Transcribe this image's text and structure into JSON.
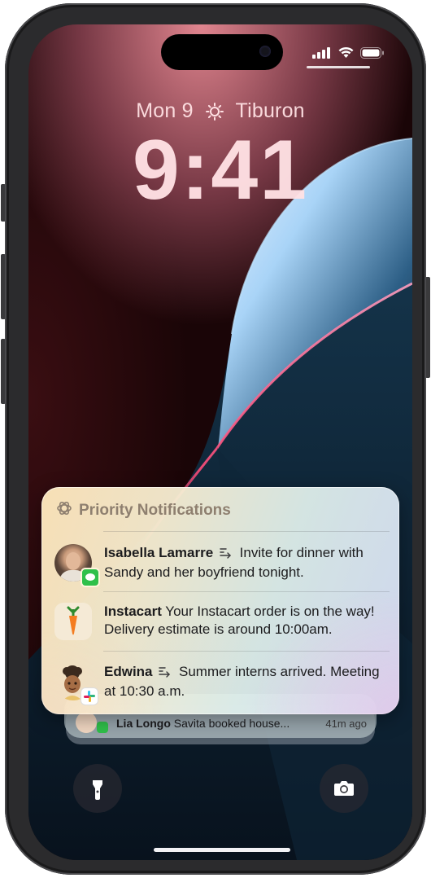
{
  "status_bar": {
    "signal_icon": "cellular-signal-icon",
    "wifi_icon": "wifi-icon",
    "battery_icon": "battery-icon"
  },
  "lock_screen": {
    "date": "Mon 9",
    "weather_icon": "sun-icon",
    "location": "Tiburon",
    "time": "9:41"
  },
  "priority_notifications": {
    "header_icon": "apple-intelligence-icon",
    "title": "Priority Notifications",
    "items": [
      {
        "sender": "Isabella Lamarre",
        "summary_icon": "summary-icon",
        "message": "Invite for dinner with Sandy and her boyfriend tonight.",
        "app_badge": "messages-icon"
      },
      {
        "sender": "Instacart",
        "message": "Your Instacart order is on the way! Delivery estimate is around 10:00am.",
        "app_icon": "carrot-icon"
      },
      {
        "sender": "Edwina",
        "summary_icon": "summary-icon",
        "message": "Summer interns arrived. Meeting at 10:30 a.m.",
        "app_badge": "slack-icon"
      }
    ]
  },
  "stacked_notification": {
    "sender": "Lia Longo",
    "message": "Savita booked house...",
    "time": "41m ago",
    "app_badge": "messages-icon"
  },
  "quick_actions": {
    "left_icon": "flashlight-icon",
    "right_icon": "camera-icon"
  },
  "colors": {
    "clock_text": "#ffe1e4",
    "priority_header_text": "#8e7f6f",
    "messages_green": "#2fc04a"
  }
}
